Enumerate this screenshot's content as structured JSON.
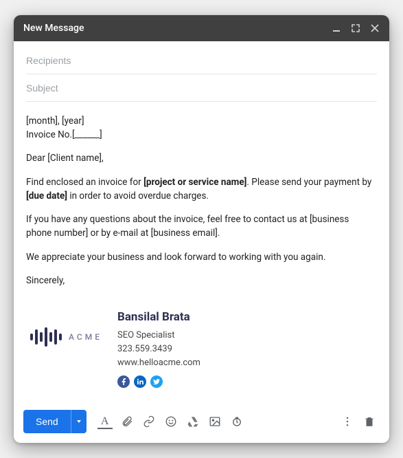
{
  "titlebar": {
    "title": "New Message"
  },
  "fields": {
    "recipients_placeholder": "Recipients",
    "recipients_value": "",
    "subject_placeholder": "Subject",
    "subject_value": ""
  },
  "body": {
    "line1": "[month], [year]",
    "line2": "Invoice No.[______]",
    "salutation": "Dear [Client name],",
    "p1_pre": "Find enclosed an invoice for ",
    "p1_bold1": "[project or service name]",
    "p1_mid": ". Please send your payment by ",
    "p1_bold2": "[due date]",
    "p1_post": " in order to avoid overdue charges.",
    "p2": "If you have any questions about the invoice, feel free to contact us at [business phone number] or by e-mail at [business email].",
    "p3": "We appreciate your business and look forward to working with you again.",
    "signoff": "Sincerely,"
  },
  "signature": {
    "logo_word": "ACME",
    "name": "Bansilal Brata",
    "title": "SEO Specialist",
    "phone": "323.559.3439",
    "website": "www.helloacme.com"
  },
  "toolbar": {
    "send_label": "Send"
  }
}
